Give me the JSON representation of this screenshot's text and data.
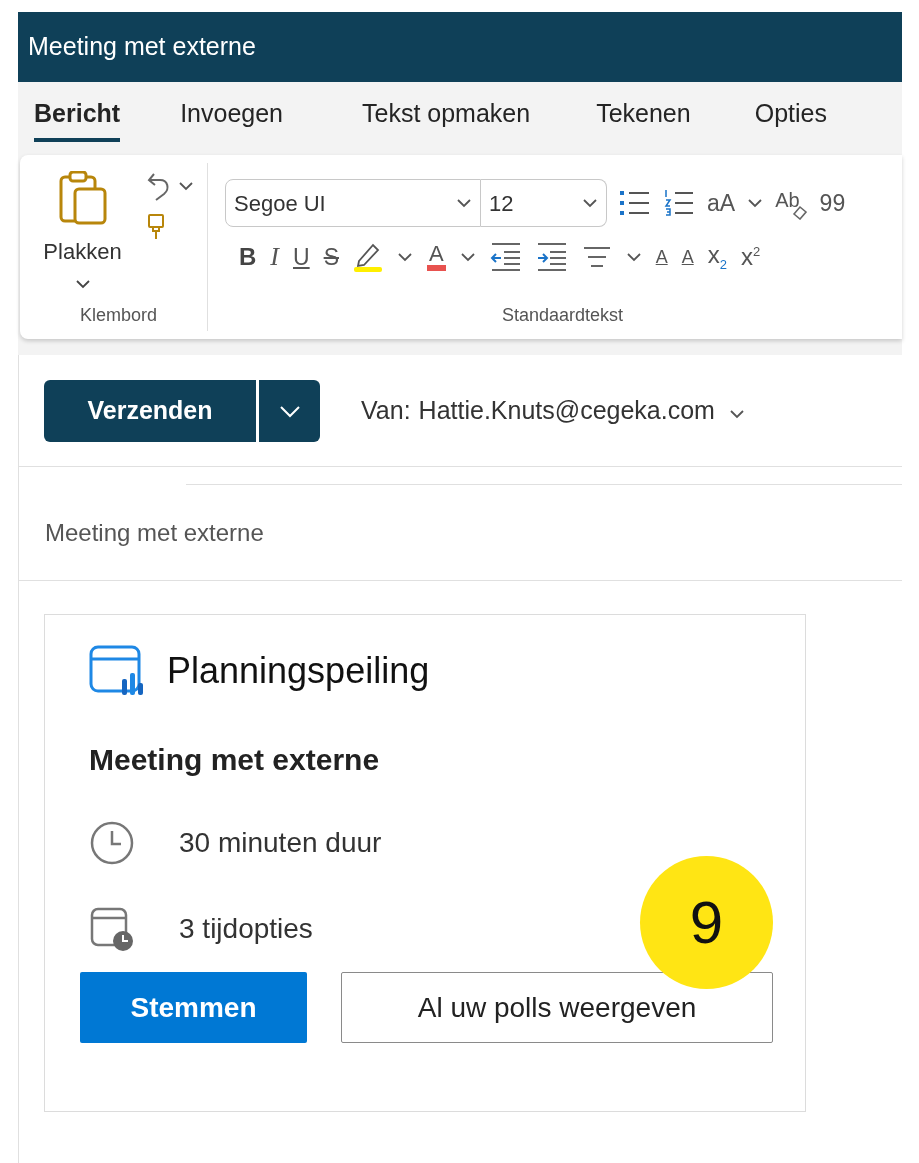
{
  "window": {
    "title": "Meeting met externe"
  },
  "tabs": [
    {
      "label": "Bericht",
      "selected": true
    },
    {
      "label": "Invoegen",
      "selected": false
    },
    {
      "label": "Tekst opmaken",
      "selected": false
    },
    {
      "label": "Tekenen",
      "selected": false
    },
    {
      "label": "Opties",
      "selected": false
    }
  ],
  "ribbon": {
    "clipboard": {
      "paste_label": "Plakken",
      "group_label": "Klembord"
    },
    "text_group": {
      "font": "Segoe UI",
      "size": "12",
      "group_label": "Standaardtekst",
      "row_1": [
        {
          "kind": "bullets"
        },
        {
          "kind": "numbering"
        },
        {
          "kind": "case",
          "text": "aA"
        },
        {
          "kind": "caret"
        },
        {
          "kind": "eraser",
          "text": "Ab"
        },
        {
          "kind": "quote",
          "text": "99"
        }
      ],
      "row_2": [
        {
          "kind": "bold",
          "text": "B"
        },
        {
          "kind": "italic",
          "text": "I"
        },
        {
          "kind": "underline",
          "text": "U"
        },
        {
          "kind": "strike",
          "text": "S"
        },
        {
          "kind": "highlight"
        },
        {
          "kind": "caret"
        },
        {
          "kind": "fontcolor",
          "text": "A"
        },
        {
          "kind": "caret"
        },
        {
          "kind": "outdent"
        },
        {
          "kind": "indent"
        },
        {
          "kind": "align"
        },
        {
          "kind": "caret"
        },
        {
          "kind": "ltr",
          "text": "A"
        },
        {
          "kind": "rtl",
          "text": "A"
        },
        {
          "kind": "subscript",
          "text": "x",
          "sub": "2"
        },
        {
          "kind": "superscript",
          "text": "x",
          "sub": "2"
        }
      ]
    }
  },
  "compose": {
    "send_label": "Verzenden",
    "from_label": "Van:",
    "from_address": "Hattie.Knuts@cegeka.com",
    "subject": "Meeting met externe"
  },
  "poll_card": {
    "title": "Planningspeiling",
    "meeting": "Meeting met externe",
    "duration": "30 minuten duur",
    "options": "3 tijdopties",
    "vote_button": "Stemmen",
    "view_button": "Al uw polls weergeven"
  },
  "step_badge": "9"
}
